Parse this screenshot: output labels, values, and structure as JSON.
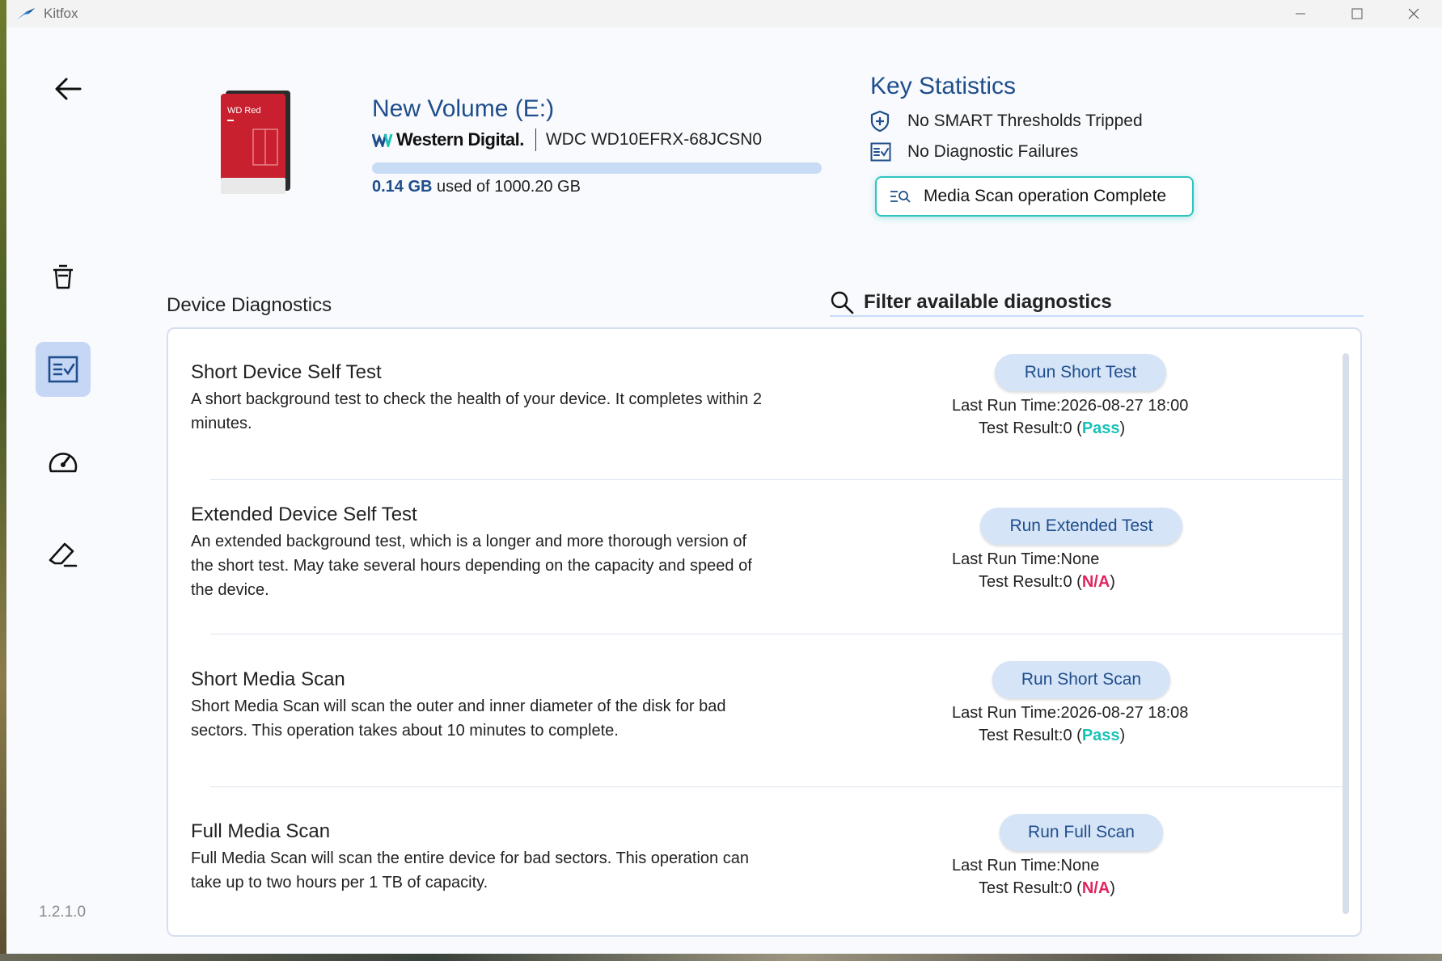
{
  "window": {
    "title": "Kitfox"
  },
  "sidebar": {
    "items": [
      {
        "icon": "trash-bin-icon"
      },
      {
        "icon": "checklist-icon",
        "active": true
      },
      {
        "icon": "speedometer-icon"
      },
      {
        "icon": "eraser-icon"
      }
    ],
    "version": "1.2.1.0"
  },
  "drive": {
    "label_line1": "WD Red",
    "title": "New Volume (E:)",
    "brand": "Western Digital.",
    "model": "WDC WD10EFRX-68JCSN0",
    "used": "0.14 GB",
    "used_suffix": "used of 1000.20 GB",
    "usage_fraction": 0.00014
  },
  "key_statistics": {
    "title": "Key Statistics",
    "stats": [
      {
        "icon": "shield-plus-icon",
        "text": "No SMART Thresholds Tripped"
      },
      {
        "icon": "checklist-icon",
        "text": "No Diagnostic Failures"
      }
    ],
    "status_pill": {
      "icon": "scan-search-icon",
      "text": "Media Scan operation Complete"
    }
  },
  "diagnostics": {
    "title": "Device Diagnostics",
    "filter_placeholder": "Filter available diagnostics",
    "items": [
      {
        "title": "Short Device Self Test",
        "description": "A short background test to check the health of your device. It completes within 2 minutes.",
        "button": "Run Short Test",
        "last_run": "Last Run Time:2026-08-27 18:00",
        "result_prefix": "Test Result:0 (",
        "result_status": "Pass",
        "result_suffix": ")"
      },
      {
        "title": "Extended Device Self Test",
        "description": "An extended background test, which is a longer and more thorough version of the short test. May take several hours depending on the capacity and speed of the device.",
        "button": "Run Extended Test",
        "last_run": "Last Run Time:None",
        "result_prefix": "Test Result:0 (",
        "result_status": "N/A",
        "result_suffix": ")"
      },
      {
        "title": "Short Media Scan",
        "description": "Short Media Scan will scan the outer and inner diameter of the disk for bad sectors. This operation takes about 10 minutes to complete.",
        "button": "Run Short Scan",
        "last_run": "Last Run Time:2026-08-27 18:08",
        "result_prefix": "Test Result:0 (",
        "result_status": "Pass",
        "result_suffix": ")"
      },
      {
        "title": "Full Media Scan",
        "description": "Full Media Scan will scan the entire device for bad sectors. This operation can take up to two hours per 1 TB of capacity.",
        "button": "Run Full Scan",
        "last_run": "Last Run Time:None",
        "result_prefix": "Test Result:0 (",
        "result_status": "N/A",
        "result_suffix": ")"
      }
    ]
  },
  "colors": {
    "accent": "#1f4e8c",
    "pass": "#17c2b6",
    "na": "#e0245e",
    "button_bg": "#d6e4f7",
    "pill_border": "#2fc4c0"
  }
}
